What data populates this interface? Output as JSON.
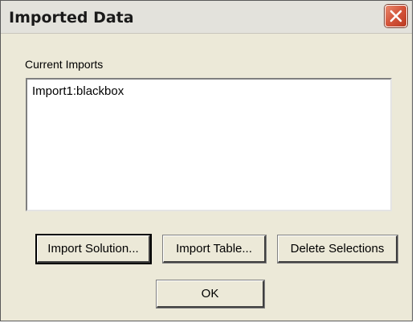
{
  "window": {
    "title": "Imported Data"
  },
  "imports": {
    "label": "Current Imports",
    "items": [
      "Import1:blackbox"
    ]
  },
  "buttons": {
    "import_solution": "Import Solution...",
    "import_table": "Import Table...",
    "delete_selections": "Delete Selections",
    "ok": "OK"
  },
  "icons": {
    "close": "close-icon"
  },
  "colors": {
    "close_button": "#d4543a",
    "dialog_face": "#ece9d8"
  }
}
